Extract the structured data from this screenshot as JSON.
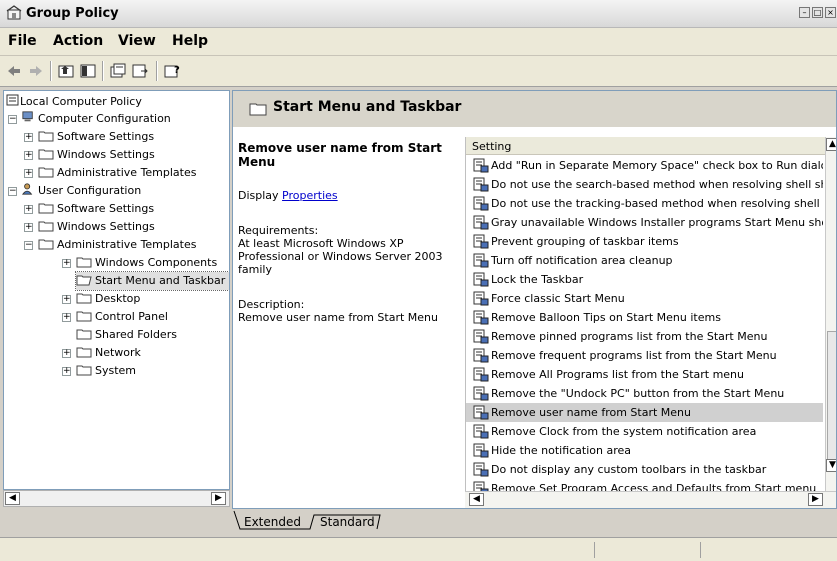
{
  "window": {
    "title": "Group Policy"
  },
  "menu": {
    "items": [
      "File",
      "Action",
      "View",
      "Help"
    ]
  },
  "toolbar": {
    "buttons": [
      "back-icon",
      "forward-icon",
      "up-folder-icon",
      "show-hide-tree-icon",
      "properties-icon",
      "export-list-icon",
      "help-icon"
    ]
  },
  "tree": {
    "root": "Local Computer Policy",
    "computer_config": "Computer Configuration",
    "cc_software": "Software Settings",
    "cc_windows": "Windows Settings",
    "cc_admin": "Administrative Templates",
    "user_config": "User Configuration",
    "uc_software": "Software Settings",
    "uc_windows": "Windows Settings",
    "uc_admin": "Administrative Templates",
    "windows_components": "Windows Components",
    "start_menu": "Start Menu and Taskbar",
    "desktop": "Desktop",
    "control_panel": "Control Panel",
    "shared_folders": "Shared Folders",
    "network": "Network",
    "system": "System"
  },
  "right": {
    "header": "Start Menu and Taskbar",
    "desc_title": "Remove user name from Start Menu",
    "display_prefix": "Display ",
    "display_link": "Properties",
    "requirements_label": "Requirements:",
    "requirements_text": "At least Microsoft Windows XP Professional or Windows Server 2003 family",
    "description_label": "Description:",
    "description_text": "Remove user name from Start Menu",
    "list_header": "Setting",
    "settings": [
      "Add \"Run in Separate Memory Space\" check box to Run dialo",
      "Do not use the search-based method when resolving shell sh",
      "Do not use the tracking-based method when resolving shell s",
      "Gray unavailable Windows Installer programs Start Menu sho",
      "Prevent grouping of taskbar items",
      "Turn off notification area cleanup",
      "Lock the Taskbar",
      "Force classic Start Menu",
      "Remove Balloon Tips on Start Menu items",
      "Remove pinned programs list from the Start Menu",
      "Remove frequent programs list from the Start Menu",
      "Remove All Programs list from the Start menu",
      "Remove the \"Undock PC\" button from the Start Menu",
      "Remove user name from Start Menu",
      "Remove Clock from the system notification area",
      "Hide the notification area",
      "Do not display any custom toolbars in the taskbar",
      "Remove Set Program Access and Defaults from Start menu"
    ],
    "selected_index": 13
  },
  "tabs": {
    "extended": "Extended",
    "standard": "Standard"
  }
}
